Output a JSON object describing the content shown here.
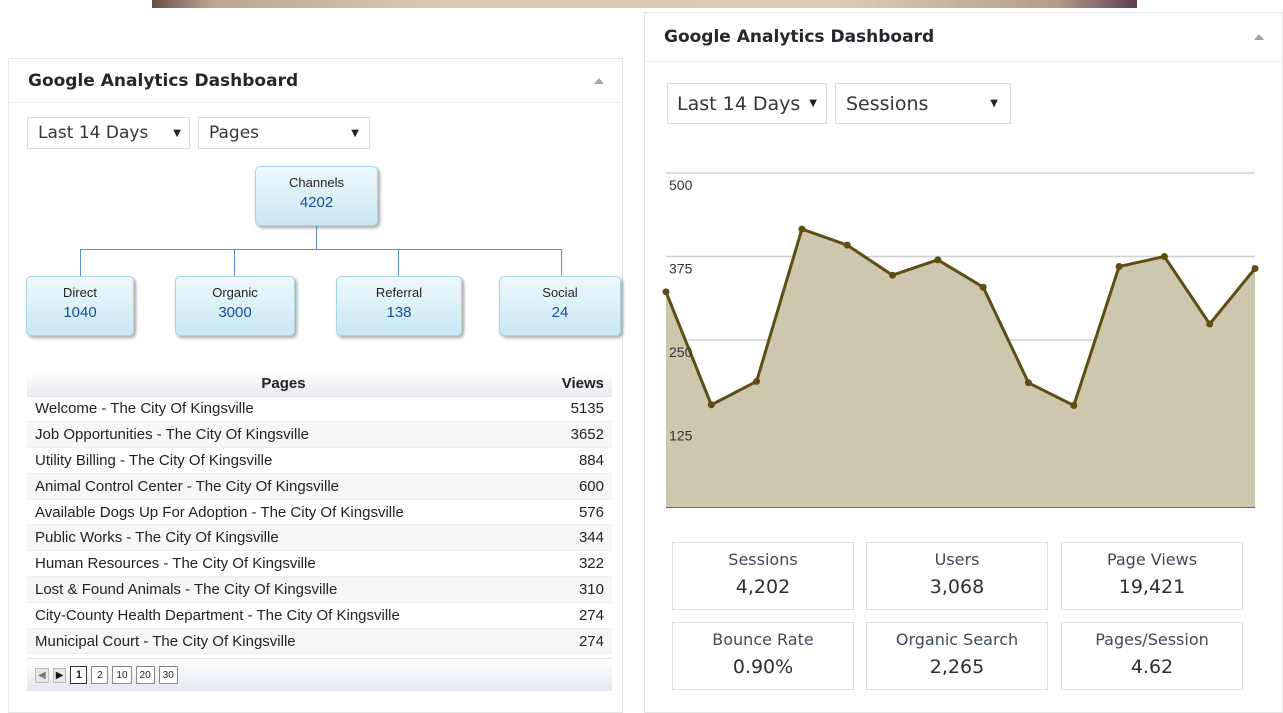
{
  "left_widget": {
    "title": "Google Analytics Dashboard",
    "period": "Last 14 Days",
    "report": "Pages",
    "tree": {
      "root": {
        "label": "Channels",
        "value": "4202"
      },
      "children": [
        {
          "label": "Direct",
          "value": "1040"
        },
        {
          "label": "Organic",
          "value": "3000"
        },
        {
          "label": "Referral",
          "value": "138"
        },
        {
          "label": "Social",
          "value": "24"
        }
      ]
    },
    "table": {
      "headers": [
        "Pages",
        "Views"
      ],
      "rows": [
        [
          "Welcome - The City Of Kingsville",
          "5135"
        ],
        [
          "Job Opportunities - The City Of Kingsville",
          "3652"
        ],
        [
          "Utility Billing - The City Of Kingsville",
          "884"
        ],
        [
          "Animal Control Center - The City Of Kingsville",
          "600"
        ],
        [
          "Available Dogs Up For Adoption - The City Of Kingsville",
          "576"
        ],
        [
          "Public Works - The City Of Kingsville",
          "344"
        ],
        [
          "Human Resources - The City Of Kingsville",
          "322"
        ],
        [
          "Lost & Found Animals - The City Of Kingsville",
          "310"
        ],
        [
          "City-County Health Department - The City Of Kingsville",
          "274"
        ],
        [
          "Municipal Court - The City Of Kingsville",
          "274"
        ]
      ]
    },
    "pager": {
      "pages": [
        "1",
        "2",
        "10",
        "20",
        "30"
      ],
      "active": "1"
    }
  },
  "right_widget": {
    "title": "Google Analytics Dashboard",
    "period": "Last 14 Days",
    "metric": "Sessions",
    "stats": [
      {
        "label": "Sessions",
        "value": "4,202"
      },
      {
        "label": "Users",
        "value": "3,068"
      },
      {
        "label": "Page Views",
        "value": "19,421"
      },
      {
        "label": "Bounce Rate",
        "value": "0.90%"
      },
      {
        "label": "Organic Search",
        "value": "2,265"
      },
      {
        "label": "Pages/Session",
        "value": "4.62"
      }
    ]
  },
  "chart_data": {
    "type": "area",
    "y_ticks": [
      "500",
      "375",
      "250",
      "125"
    ],
    "ylim": [
      0,
      500
    ],
    "values": [
      322,
      153,
      188,
      416,
      392,
      347,
      370,
      329,
      186,
      152,
      360,
      375,
      274,
      357
    ],
    "colors": {
      "line": "#5e4d14",
      "fill": "#cdc7ae",
      "point": "#5e4d14"
    }
  }
}
